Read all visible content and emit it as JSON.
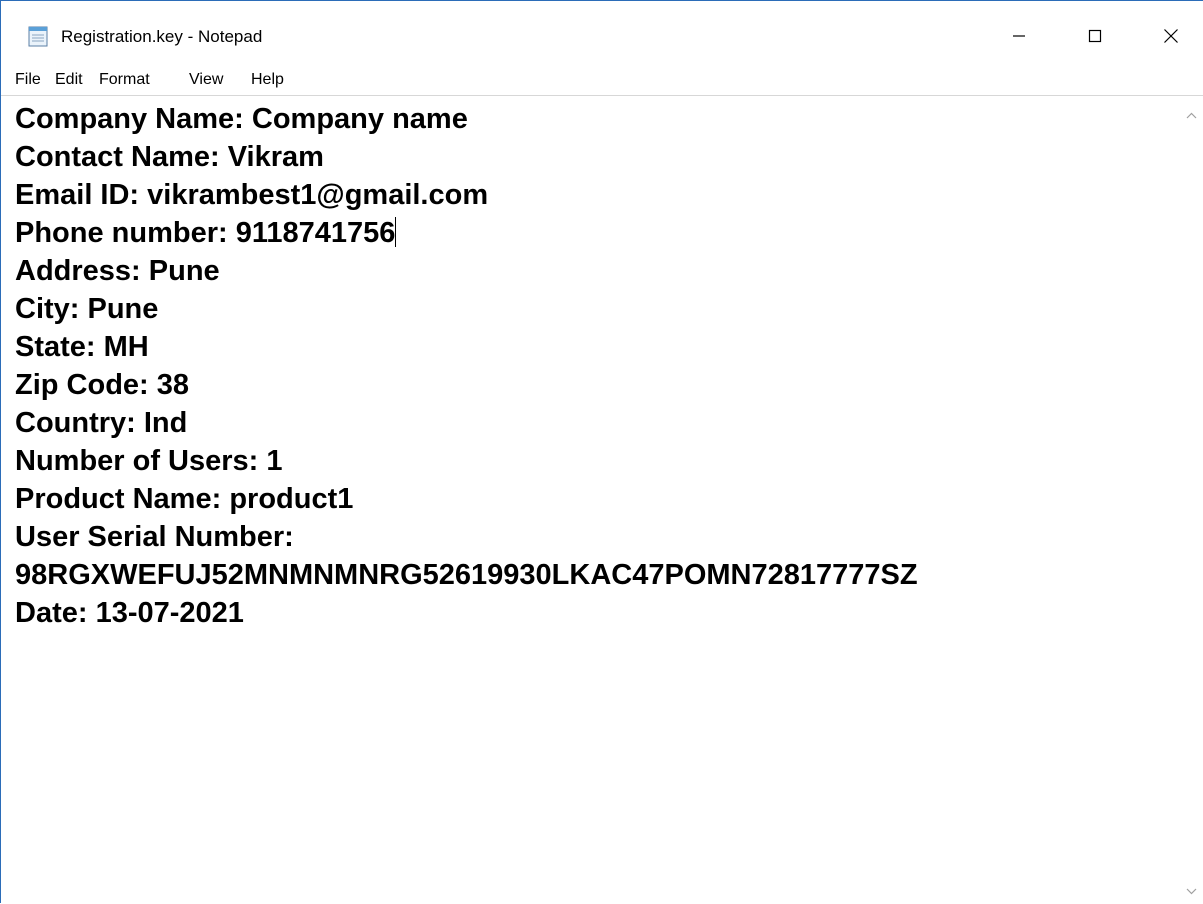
{
  "window": {
    "title": "Registration.key - Notepad"
  },
  "menu": {
    "items": [
      {
        "label": "File"
      },
      {
        "label": "Edit"
      },
      {
        "label": "Format"
      },
      {
        "label": "View"
      },
      {
        "label": "Help"
      }
    ]
  },
  "document": {
    "lines": [
      "Company Name: Company name",
      "Contact Name: Vikram",
      "Email ID: vikrambest1@gmail.com",
      "Phone number: 9118741756",
      "Address: Pune",
      "City: Pune",
      "State: MH",
      "Zip Code: 38",
      "Country: Ind",
      "Number of Users: 1",
      "Product Name: product1",
      "User Serial Number:",
      "98RGXWEFUJ52MNMNMNRG52619930LKAC47POMN72817777SZ",
      "Date: 13-07-2021"
    ]
  },
  "icons": {
    "app": "notepad-icon",
    "minimize": "minimize-icon",
    "maximize": "maximize-icon",
    "close": "close-icon",
    "scroll_up": "chevron-up-icon",
    "scroll_down": "chevron-down-icon"
  },
  "colors": {
    "window_border": "#2b6cb8",
    "text": "#000000",
    "background": "#ffffff"
  }
}
